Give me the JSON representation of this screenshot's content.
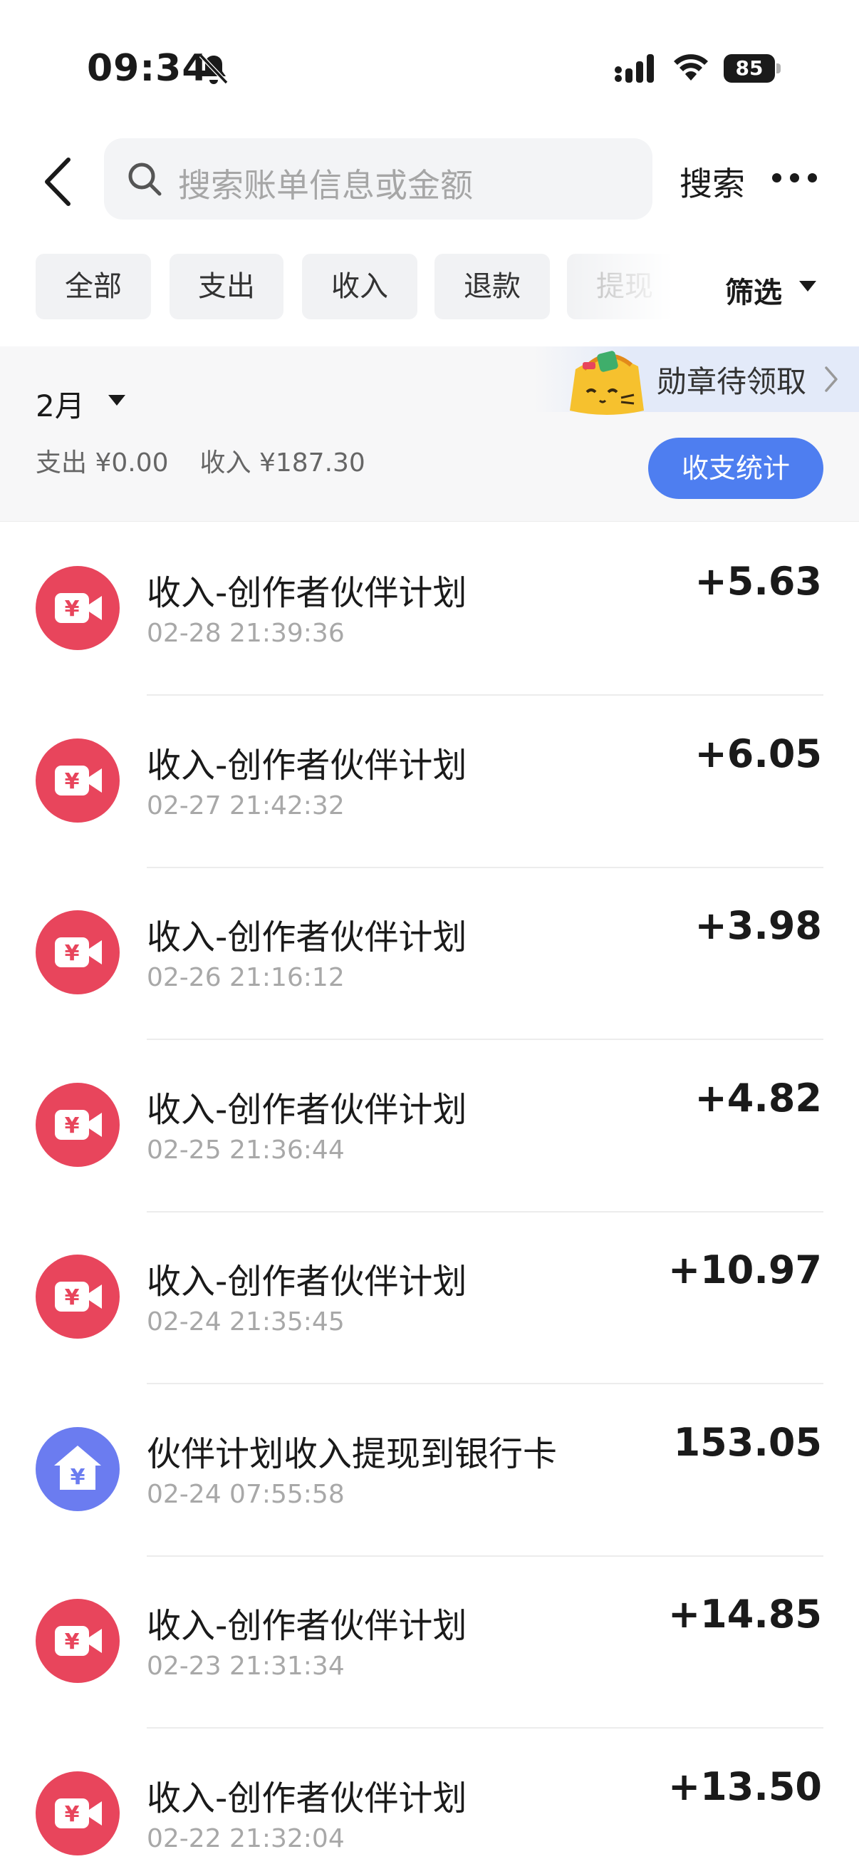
{
  "status_bar": {
    "time": "09:34",
    "battery": "85"
  },
  "header": {
    "search_placeholder": "搜索账单信息或金额",
    "search_button": "搜索"
  },
  "tabs": [
    "全部",
    "支出",
    "收入",
    "退款",
    "提现"
  ],
  "filter_label": "筛选",
  "summary": {
    "month": "2月",
    "expense": "支出 ¥0.00",
    "income": "收入 ¥187.30",
    "badge_text": "勋章待领取",
    "stats_button": "收支统计"
  },
  "colors": {
    "accent_blue": "#4e7ef0",
    "income_icon_red": "#e8455c",
    "withdraw_icon_purple": "#6b7cf0"
  },
  "transactions": [
    {
      "icon": "video-yuan-icon",
      "title": "收入-创作者伙伴计划",
      "time": "02-28 21:39:36",
      "amount": "+5.63"
    },
    {
      "icon": "video-yuan-icon",
      "title": "收入-创作者伙伴计划",
      "time": "02-27 21:42:32",
      "amount": "+6.05"
    },
    {
      "icon": "video-yuan-icon",
      "title": "收入-创作者伙伴计划",
      "time": "02-26 21:16:12",
      "amount": "+3.98"
    },
    {
      "icon": "video-yuan-icon",
      "title": "收入-创作者伙伴计划",
      "time": "02-25 21:36:44",
      "amount": "+4.82"
    },
    {
      "icon": "video-yuan-icon",
      "title": "收入-创作者伙伴计划",
      "time": "02-24 21:35:45",
      "amount": "+10.97"
    },
    {
      "icon": "bank-withdraw-icon",
      "title": "伙伴计划收入提现到银行卡",
      "time": "02-24 07:55:58",
      "amount": "153.05"
    },
    {
      "icon": "video-yuan-icon",
      "title": "收入-创作者伙伴计划",
      "time": "02-23 21:31:34",
      "amount": "+14.85"
    },
    {
      "icon": "video-yuan-icon",
      "title": "收入-创作者伙伴计划",
      "time": "02-22 21:32:04",
      "amount": "+13.50"
    }
  ]
}
